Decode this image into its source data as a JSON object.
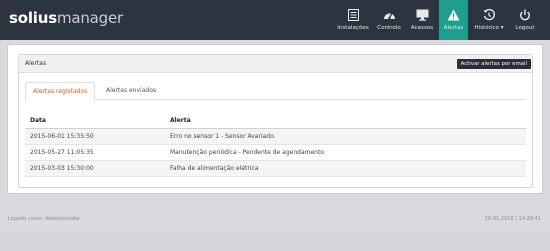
{
  "app": {
    "logo_primary": "solius",
    "logo_secondary": "manager"
  },
  "nav": {
    "items": [
      {
        "label": "Instalações",
        "icon": "list-icon"
      },
      {
        "label": "Controlo",
        "icon": "gauge-icon"
      },
      {
        "label": "Acessos",
        "icon": "monitor-icon"
      },
      {
        "label": "Alertas",
        "icon": "warning-icon",
        "active": true
      },
      {
        "label": "Histórico ▾",
        "icon": "history-icon"
      },
      {
        "label": "Logout",
        "icon": "power-icon"
      }
    ]
  },
  "panel": {
    "title": "Alertas",
    "email_button": "Activar alertas por email",
    "tabs": [
      {
        "label": "Alertas registados",
        "active": true
      },
      {
        "label": "Alertas enviados",
        "active": false
      }
    ],
    "table": {
      "headers": [
        "Data",
        "Alerta"
      ],
      "rows": [
        [
          "2015-06-01 15:35:50",
          "Erro no sensor 1 - Sensor Avariado."
        ],
        [
          "2015-05-27 11:05:35",
          "Manutenção periódica - Pendente de agendamento"
        ],
        [
          "2015-03-03 15:30:00",
          "Falha de alimentação elétrica"
        ]
      ]
    }
  },
  "footer": {
    "left": "Logado como: Administrador",
    "right": "29-01-2016 | 14:28:41"
  },
  "colors": {
    "topbar": "#2c3440",
    "accent_active": "#1f9e8f",
    "tab_active": "#e0582a"
  }
}
